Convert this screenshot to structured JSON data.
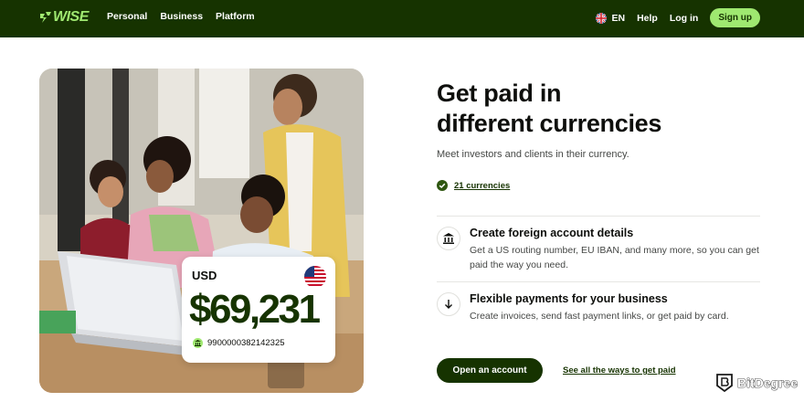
{
  "nav": {
    "logo_text": "WISE",
    "links": [
      "Personal",
      "Business",
      "Platform"
    ],
    "lang": "EN",
    "help": "Help",
    "login": "Log in",
    "signup": "Sign up"
  },
  "hero": {
    "title_line1": "Get paid in",
    "title_line2": "different currencies",
    "subtitle": "Meet investors and clients in their currency.",
    "currencies_link": "21 currencies"
  },
  "features": [
    {
      "icon": "bank-icon",
      "title": "Create foreign account details",
      "desc": "Get a US routing number, EU IBAN, and many more, so you can get paid the way you need."
    },
    {
      "icon": "arrow-down-icon",
      "title": "Flexible payments for your business",
      "desc": "Create invoices, send fast payment links, or get paid by card."
    }
  ],
  "card": {
    "currency": "USD",
    "amount": "$69,231",
    "account": "9900000382142325"
  },
  "cta": {
    "open_account": "Open an account",
    "see_all": "See all the ways to get paid"
  },
  "watermark": "BitDegree",
  "colors": {
    "brand_dark": "#163300",
    "brand_green": "#9fe870"
  }
}
